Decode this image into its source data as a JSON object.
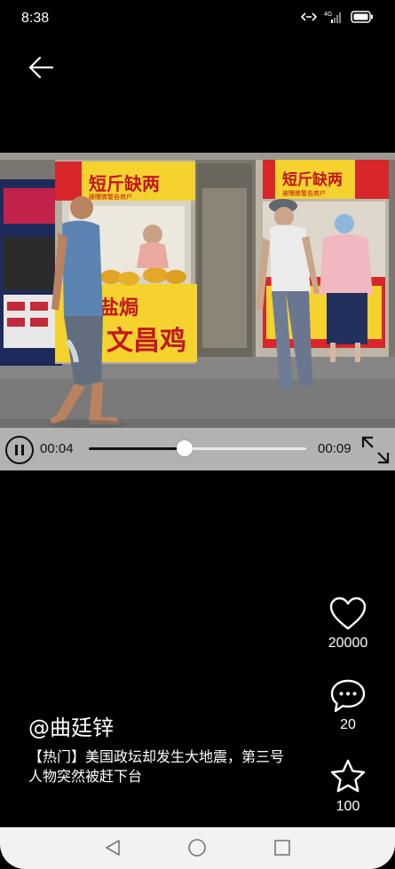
{
  "status_bar": {
    "time": "8:38",
    "network": "4G"
  },
  "video": {
    "current_time": "00:04",
    "total_time": "00:09",
    "progress": 0.44,
    "playing": true,
    "sign_left_top": "短斤缺两",
    "sign_left_bottom_a": "盐焗",
    "sign_left_bottom_b": "文昌鸡",
    "sign_right_top": "短斤缺两",
    "sign_left_sub": "被曝脾警告商户",
    "sign_right_sub": "被曝脾警告商户"
  },
  "actions": {
    "like_count": "20000",
    "comment_count": "20",
    "favorite_count": "100"
  },
  "post": {
    "author": "@曲廷锌",
    "caption": "【热门】美国政坛却发生大地震，第三号人物突然被赶下台"
  },
  "icons": {
    "back": "arrow-left-icon",
    "play_pause": "pause-icon",
    "fullscreen": "expand-icon",
    "like": "heart-icon",
    "comment": "comment-bubble-icon",
    "favorite": "star-icon",
    "nav_back": "triangle-back-icon",
    "nav_home": "circle-home-icon",
    "nav_recent": "square-recent-icon"
  },
  "colors": {
    "background": "#000000",
    "sign_yellow": "#f5d22e",
    "sign_red": "#d9262b",
    "nav_bar": "#f2f2f2"
  }
}
